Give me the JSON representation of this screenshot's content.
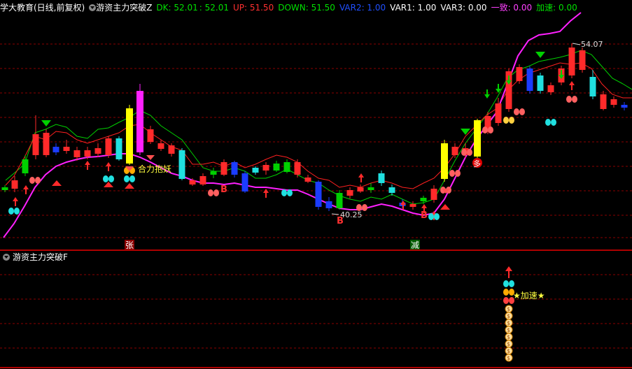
{
  "header": {
    "source": "学大教育(日线,前复权)",
    "indicator_name": "游资主力突破Z",
    "dk_label": "DK: 52.01",
    "dk_value2": ": 52.01",
    "up_label": "UP: 51.50",
    "down_label": "DOWN: 51.50",
    "var2_label": "VAR2: 1.00",
    "var1_label": "VAR1: 1.00",
    "var3_label": "VAR3: 0.00",
    "yizhi_label": "一致: 0.00",
    "jiasu_label": "加速: 0.00"
  },
  "sub_header": {
    "indicator_name": "游资主力突破F"
  },
  "annotations": {
    "hefeng": "合力抱妖",
    "low_price": "40.25",
    "high_price": "54.07",
    "zhang": "张",
    "jian": "减",
    "duo": "多",
    "b1": "B",
    "b2": "B",
    "b3": "B",
    "jiasu": "★加速★",
    "coin": "$"
  },
  "colors": {
    "up": "#ff2a2a",
    "down": "#1b3cff",
    "green": "#00d000",
    "cyan": "#20e0e0",
    "yellow": "#ffff00",
    "magenta": "#ff20ff",
    "grid": "#8b0000"
  },
  "chart_data": {
    "type": "candlestick",
    "low_marker": 40.25,
    "high_marker": 54.07
  }
}
